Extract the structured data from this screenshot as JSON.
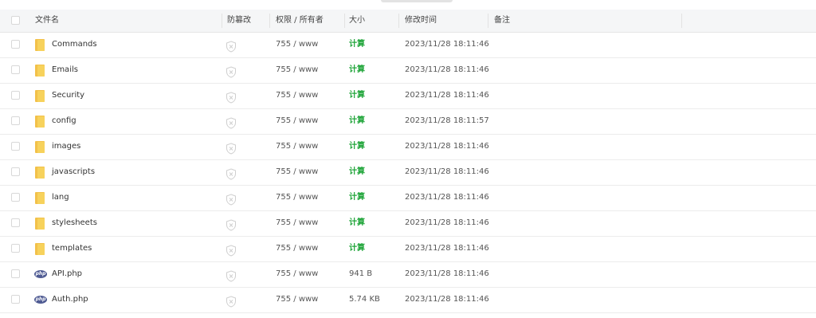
{
  "header": {
    "name": "文件名",
    "protect": "防篡改",
    "perm": "权限 / 所有者",
    "size": "大小",
    "mtime": "修改时间",
    "note": "备注"
  },
  "rows": [
    {
      "name": "Commands",
      "type": "folder",
      "perm": "755 / www",
      "size": "计算",
      "mtime": "2023/11/28 18:11:46",
      "icon": "folder-icon"
    },
    {
      "name": "Emails",
      "type": "folder",
      "perm": "755 / www",
      "size": "计算",
      "mtime": "2023/11/28 18:11:46",
      "icon": "folder-icon"
    },
    {
      "name": "Security",
      "type": "folder",
      "perm": "755 / www",
      "size": "计算",
      "mtime": "2023/11/28 18:11:46",
      "icon": "folder-icon"
    },
    {
      "name": "config",
      "type": "folder",
      "perm": "755 / www",
      "size": "计算",
      "mtime": "2023/11/28 18:11:57",
      "icon": "folder-icon"
    },
    {
      "name": "images",
      "type": "folder",
      "perm": "755 / www",
      "size": "计算",
      "mtime": "2023/11/28 18:11:46",
      "icon": "folder-icon"
    },
    {
      "name": "javascripts",
      "type": "folder",
      "perm": "755 / www",
      "size": "计算",
      "mtime": "2023/11/28 18:11:46",
      "icon": "folder-icon"
    },
    {
      "name": "lang",
      "type": "folder",
      "perm": "755 / www",
      "size": "计算",
      "mtime": "2023/11/28 18:11:46",
      "icon": "folder-icon"
    },
    {
      "name": "stylesheets",
      "type": "folder",
      "perm": "755 / www",
      "size": "计算",
      "mtime": "2023/11/28 18:11:46",
      "icon": "folder-icon"
    },
    {
      "name": "templates",
      "type": "folder",
      "perm": "755 / www",
      "size": "计算",
      "mtime": "2023/11/28 18:11:46",
      "icon": "folder-icon"
    },
    {
      "name": "API.php",
      "type": "php",
      "perm": "755 / www",
      "size": "941 B",
      "mtime": "2023/11/28 18:11:46",
      "icon": "php-file-icon"
    },
    {
      "name": "Auth.php",
      "type": "php",
      "perm": "755 / www",
      "size": "5.74 KB",
      "mtime": "2023/11/28 18:11:46",
      "icon": "php-file-icon"
    }
  ],
  "php_badge": "php",
  "colors": {
    "accent": "#20a53a",
    "folder": "#f2c14a",
    "php": "#4f5b93"
  }
}
